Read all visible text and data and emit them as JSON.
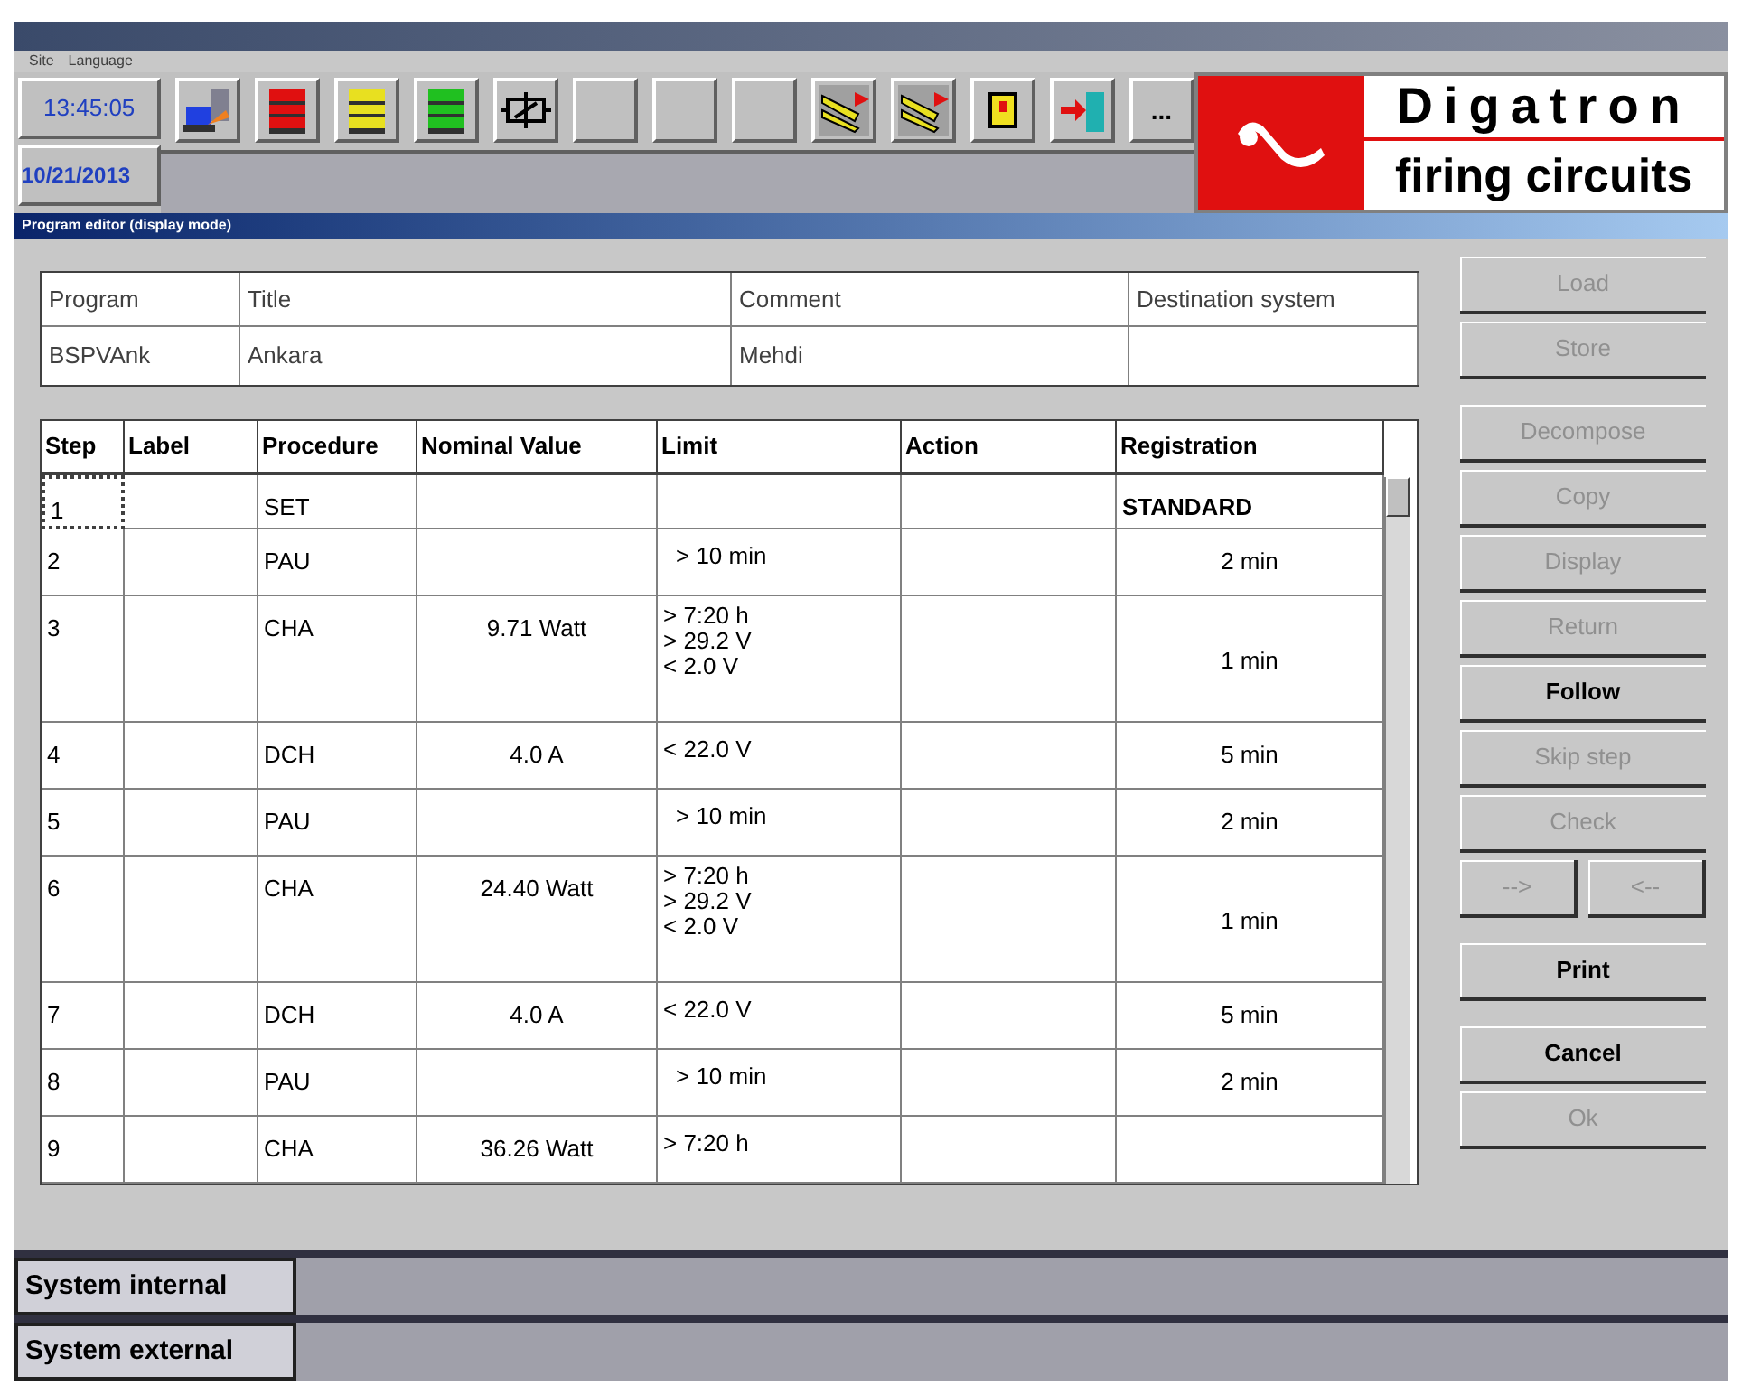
{
  "menu": [
    "Site",
    "Language"
  ],
  "clock": {
    "time": "13:45:05",
    "date": "10/21/2013"
  },
  "toolbar": [
    {
      "kind": "computer"
    },
    {
      "kind": "stack",
      "color": "#e01010"
    },
    {
      "kind": "stack",
      "color": "#e8e020"
    },
    {
      "kind": "stack",
      "color": "#20c020"
    },
    {
      "kind": "relay"
    },
    {
      "kind": "empty"
    },
    {
      "kind": "empty"
    },
    {
      "kind": "empty"
    },
    {
      "kind": "transfer"
    },
    {
      "kind": "transfer"
    },
    {
      "kind": "help"
    },
    {
      "kind": "exit"
    },
    {
      "kind": "more",
      "label": "..."
    }
  ],
  "logo": {
    "name": "Digatron",
    "tagline": "firing circuits"
  },
  "editor_title": "Program editor (display mode)",
  "program": {
    "columns": [
      "Program",
      "Title",
      "Comment",
      "Destination system"
    ],
    "values": [
      "BSPVAnk",
      "Ankara",
      "Mehdi"
    ]
  },
  "steps": {
    "columns": [
      "Step",
      "Label",
      "Procedure",
      "Nominal Value",
      "Limit",
      "Action",
      "Registration"
    ],
    "rows": [
      {
        "step": "1",
        "procedure": "SET",
        "nominal": "",
        "limit": [],
        "registration": "STANDARD"
      },
      {
        "step": "2",
        "procedure": "PAU",
        "nominal": "",
        "limit": [
          "> 10 min"
        ],
        "registration": "2 min"
      },
      {
        "step": "3",
        "procedure": "CHA",
        "nominal": "9.71 Watt",
        "limit": [
          "> 7:20 h",
          "> 29.2 V",
          "< 2.0 V"
        ],
        "registration": "1 min"
      },
      {
        "step": "4",
        "procedure": "DCH",
        "nominal": "4.0 A",
        "limit": [
          "< 22.0 V"
        ],
        "registration": "5 min"
      },
      {
        "step": "5",
        "procedure": "PAU",
        "nominal": "",
        "limit": [
          "> 10 min"
        ],
        "registration": "2 min"
      },
      {
        "step": "6",
        "procedure": "CHA",
        "nominal": "24.40 Watt",
        "limit": [
          "> 7:20 h",
          "> 29.2 V",
          "< 2.0 V"
        ],
        "registration": "1 min"
      },
      {
        "step": "7",
        "procedure": "DCH",
        "nominal": "4.0 A",
        "limit": [
          "< 22.0 V"
        ],
        "registration": "5 min"
      },
      {
        "step": "8",
        "procedure": "PAU",
        "nominal": "",
        "limit": [
          "> 10 min"
        ],
        "registration": "2 min"
      },
      {
        "step": "9",
        "procedure": "CHA",
        "nominal": "36.26 Watt",
        "limit": [
          "> 7:20 h"
        ],
        "registration": ""
      }
    ]
  },
  "buttons": [
    {
      "kind": "single",
      "label": "Load",
      "disabled": true
    },
    {
      "kind": "single",
      "label": "Store",
      "disabled": true
    },
    {
      "kind": "gap"
    },
    {
      "kind": "single",
      "label": "Decompose",
      "disabled": true
    },
    {
      "kind": "single",
      "label": "Copy",
      "disabled": true
    },
    {
      "kind": "single",
      "label": "Display",
      "disabled": true
    },
    {
      "kind": "single",
      "label": "Return",
      "disabled": true
    },
    {
      "kind": "single",
      "label": "Follow",
      "disabled": false
    },
    {
      "kind": "single",
      "label": "Skip step",
      "disabled": true
    },
    {
      "kind": "single",
      "label": "Check",
      "disabled": true
    },
    {
      "kind": "pair",
      "labels": [
        "-->",
        "<--"
      ],
      "disabled": true
    },
    {
      "kind": "gap"
    },
    {
      "kind": "single",
      "label": "Print",
      "disabled": false
    },
    {
      "kind": "gap"
    },
    {
      "kind": "single",
      "label": "Cancel",
      "disabled": false
    },
    {
      "kind": "single",
      "label": "Ok",
      "disabled": true
    }
  ],
  "systems": [
    "System internal",
    "System external"
  ]
}
